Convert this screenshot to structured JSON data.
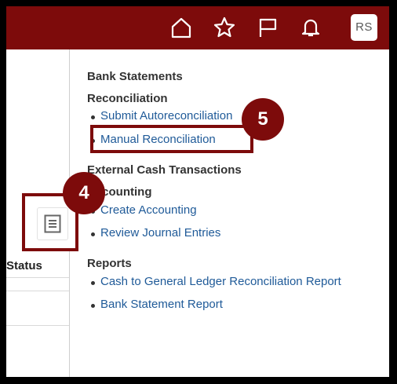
{
  "header": {
    "brand_color": "#7d0b0b",
    "icons": [
      "home-icon",
      "star-icon",
      "flag-icon",
      "bell-icon"
    ],
    "avatar_initials": "RS"
  },
  "left_panel": {
    "column_header": "Status"
  },
  "callouts": {
    "step4": "4",
    "step5": "5"
  },
  "menu": {
    "sections": [
      {
        "title": "Bank Statements",
        "items": []
      },
      {
        "title": "Reconciliation",
        "items": [
          "Submit Autoreconciliation",
          "Manual Reconciliation"
        ]
      },
      {
        "title": "External Cash Transactions",
        "items": []
      },
      {
        "title": "Accounting",
        "items": [
          "Create Accounting",
          "Review Journal Entries"
        ]
      },
      {
        "title": "Reports",
        "items": [
          "Cash to General Ledger Reconciliation Report",
          "Bank Statement Report"
        ]
      }
    ]
  }
}
